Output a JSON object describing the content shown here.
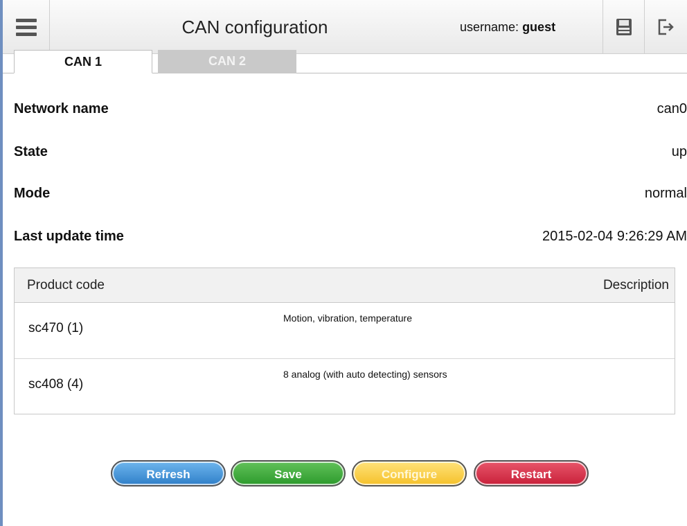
{
  "header": {
    "title": "CAN configuration",
    "username_label": "username:",
    "username": "guest",
    "icons": {
      "menu": "hamburger-menu-icon",
      "save": "floppy-disk-icon",
      "logout": "logout-icon"
    }
  },
  "tabs": [
    {
      "label": "CAN 1",
      "active": true
    },
    {
      "label": "CAN 2",
      "active": false
    }
  ],
  "info": [
    {
      "label": "Network name",
      "value": "can0"
    },
    {
      "label": "State",
      "value": "up"
    },
    {
      "label": "Mode",
      "value": "normal"
    },
    {
      "label": "Last update time",
      "value": "2015-02-04 9:26:29 AM"
    }
  ],
  "products": {
    "headers": {
      "code": "Product code",
      "description": "Description"
    },
    "rows": [
      {
        "code": "sc470 (1)",
        "description": "Motion, vibration, temperature"
      },
      {
        "code": "sc408 (4)",
        "description": "8 analog (with auto detecting) sensors"
      }
    ]
  },
  "actions": {
    "refresh": "Refresh",
    "save": "Save",
    "configure": "Configure",
    "restart": "Restart"
  },
  "colors": {
    "refresh": "#2f7fc8",
    "save": "#2c9a2c",
    "configure": "#f5c12a",
    "restart": "#c8203a"
  }
}
